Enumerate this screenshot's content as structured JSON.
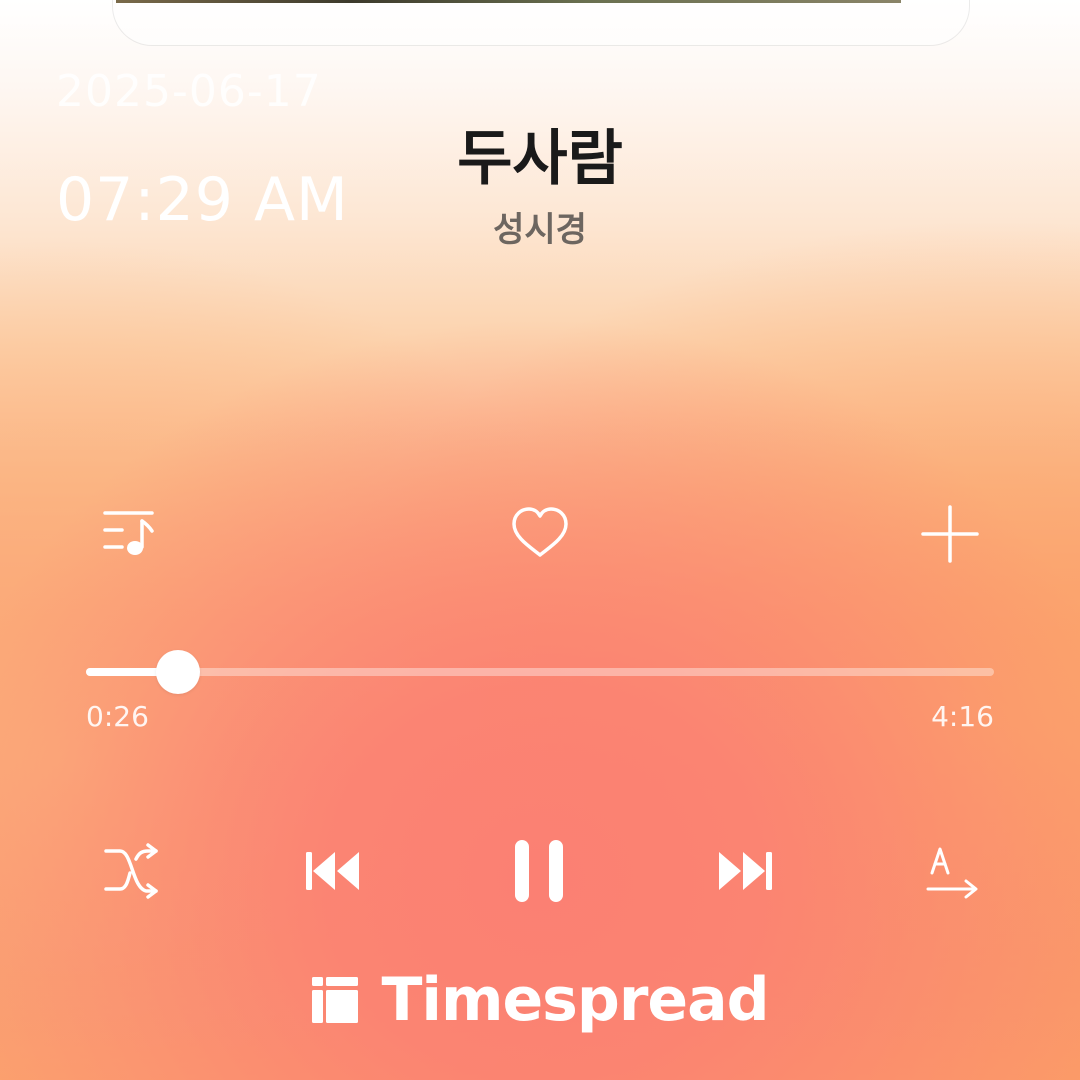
{
  "overlay": {
    "date": "2025-06-17",
    "time": "07:29 AM"
  },
  "track": {
    "title": "두사람",
    "artist": "성시경"
  },
  "actions": {
    "left_icon": "playlist-icon",
    "center_icon": "heart-icon",
    "right_icon": "plus-icon"
  },
  "progress": {
    "elapsed": "0:26",
    "total": "4:16",
    "fraction": 0.1016
  },
  "controls": {
    "shuffle_icon": "shuffle-icon",
    "previous_icon": "previous-track-icon",
    "playpause_icon": "pause-icon",
    "next_icon": "next-track-icon",
    "lyrics_icon": "translate-icon"
  },
  "watermark": {
    "brand": "Timespread"
  },
  "colors": {
    "accent": "#ffffff",
    "title": "#1a1a1a",
    "artist": "#6d6660"
  }
}
